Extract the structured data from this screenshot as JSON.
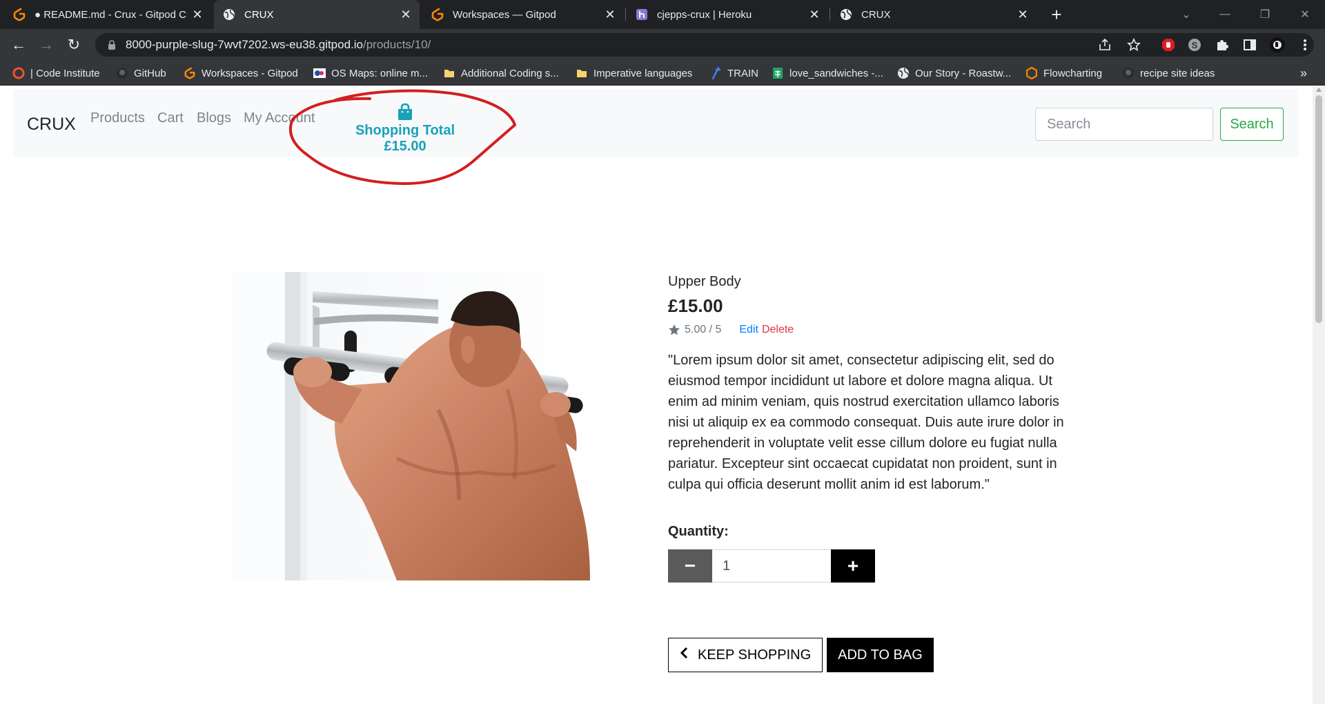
{
  "browser": {
    "tabs": [
      {
        "title": "● README.md - Crux - Gitpod Co",
        "icon": "gitpod-icon"
      },
      {
        "title": "CRUX",
        "icon": "globe-icon",
        "active": true
      },
      {
        "title": "Workspaces — Gitpod",
        "icon": "gitpod-icon"
      },
      {
        "title": "cjepps-crux | Heroku",
        "icon": "heroku-icon"
      },
      {
        "title": "CRUX",
        "icon": "globe-icon"
      }
    ],
    "url_host": "8000-purple-slug-7wvt7202.ws-eu38.gitpod.io",
    "url_path": "/products/10/",
    "bookmarks": [
      {
        "label": "| Code Institute",
        "icon": "code-institute-icon"
      },
      {
        "label": "GitHub",
        "icon": "github-icon"
      },
      {
        "label": "Workspaces - Gitpod",
        "icon": "gitpod-icon"
      },
      {
        "label": "OS Maps: online m...",
        "icon": "os-maps-icon"
      },
      {
        "label": "Additional Coding s...",
        "icon": "folder-icon"
      },
      {
        "label": "Imperative languages",
        "icon": "folder-icon"
      },
      {
        "label": "TRAIN",
        "icon": "train-icon"
      },
      {
        "label": "love_sandwiches -...",
        "icon": "sheets-icon"
      },
      {
        "label": "Our Story - Roastw...",
        "icon": "globe-icon"
      },
      {
        "label": "Flowcharting",
        "icon": "flowchart-icon"
      },
      {
        "label": "recipe site ideas",
        "icon": "github-icon"
      }
    ],
    "bookmarks_overflow": "»"
  },
  "navbar": {
    "brand": "CRUX",
    "links": [
      "Products",
      "Cart",
      "Blogs",
      "My Account"
    ],
    "bag_total": "Shopping Total £15.00",
    "search_placeholder": "Search",
    "search_button": "Search"
  },
  "product": {
    "name": "Upper Body",
    "price": "£15.00",
    "rating": "5.00 / 5",
    "edit_label": "Edit",
    "delete_label": "Delete",
    "description": "\"Lorem ipsum dolor sit amet, consectetur adipiscing elit, sed do eiusmod tempor incididunt ut labore et dolore magna aliqua. Ut enim ad minim veniam, quis nostrud exercitation ullamco laboris nisi ut aliquip ex ea commodo consequat. Duis aute irure dolor in reprehenderit in voluptate velit esse cillum dolore eu fugiat nulla pariatur. Excepteur sint occaecat cupidatat non proident, sunt in culpa qui officia deserunt mollit anim id est laborum.\"",
    "quantity_label": "Quantity:",
    "quantity_value": "1",
    "minus_symbol": "−",
    "plus_symbol": "+",
    "keep_shopping": "KEEP SHOPPING",
    "add_to_bag": "ADD TO BAG"
  },
  "colors": {
    "accent_info": "#17a2b8",
    "search_green": "#28a745",
    "annotation_red": "#d21f1f"
  }
}
